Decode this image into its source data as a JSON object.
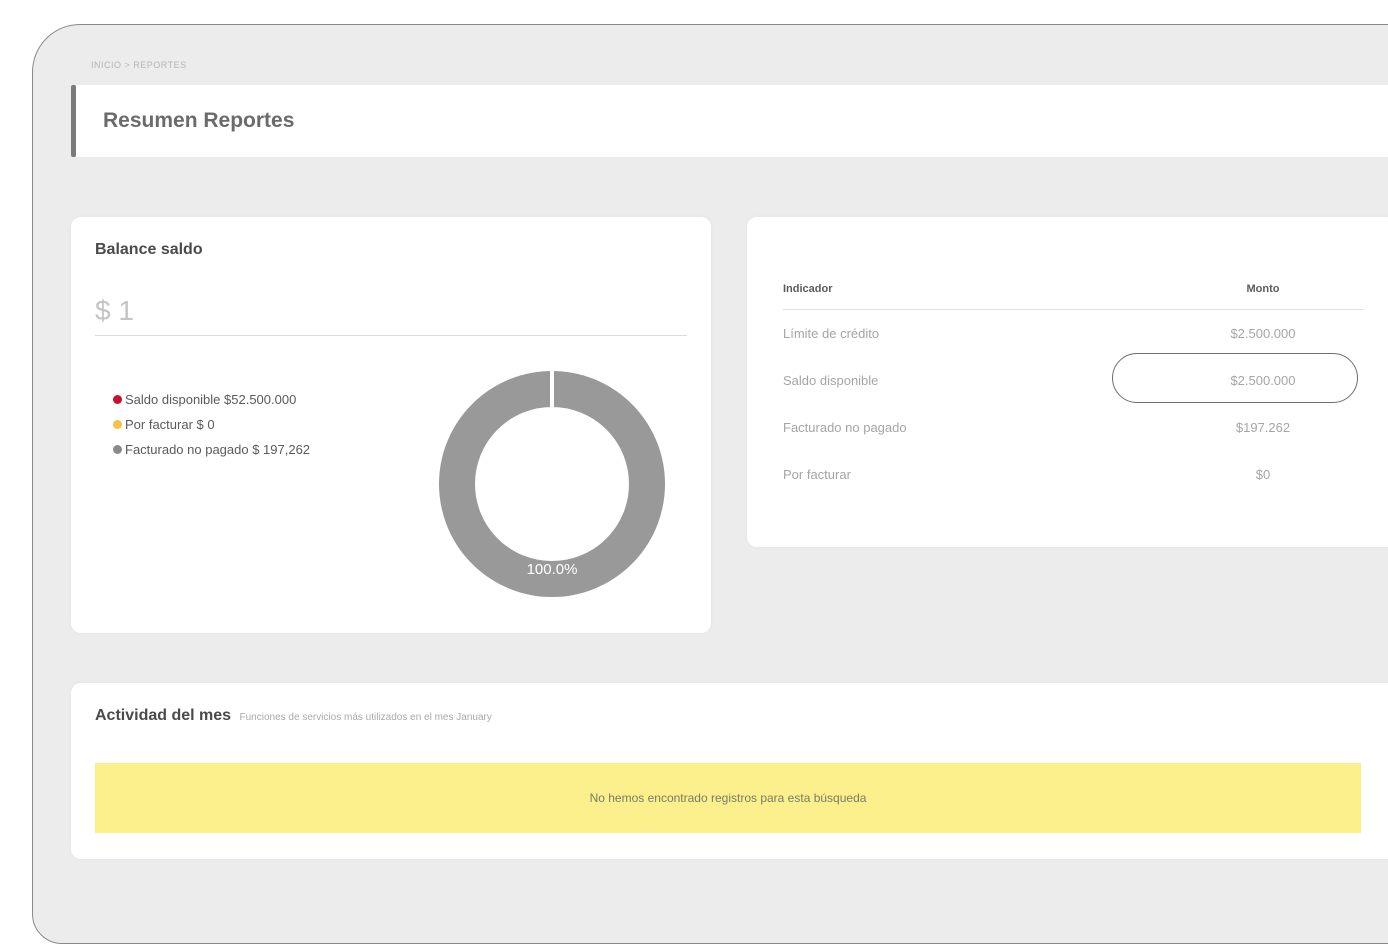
{
  "breadcrumb": "INICIO > REPORTES",
  "page": {
    "title": "Resumen Reportes"
  },
  "balance": {
    "title": "Balance saldo",
    "input_value": "$ 1",
    "legend": [
      {
        "label": "Saldo disponible $52.500.000",
        "color": "#c8102e"
      },
      {
        "label": "Por facturar $ 0",
        "color": "#f5c242"
      },
      {
        "label": "Facturado no pagado $ 197,262",
        "color": "#8a8a8a"
      }
    ],
    "donut_label": "100.0%",
    "donut_color": "#999999"
  },
  "indicators": {
    "headers": {
      "indicator": "Indicador",
      "amount": "Monto"
    },
    "rows": [
      {
        "label": "Límite de crédito",
        "value": "$2.500.000"
      },
      {
        "label": "Saldo disponible",
        "value": "$2.500.000"
      },
      {
        "label": "Facturado no pagado",
        "value": "$197.262"
      },
      {
        "label": "Por facturar",
        "value": "$0"
      }
    ]
  },
  "activity": {
    "title": "Actividad del mes",
    "subtitle": "Funciones de servicios más utilizados en el mes January",
    "empty_message": "No hemos encontrado registros para esta búsqueda"
  }
}
